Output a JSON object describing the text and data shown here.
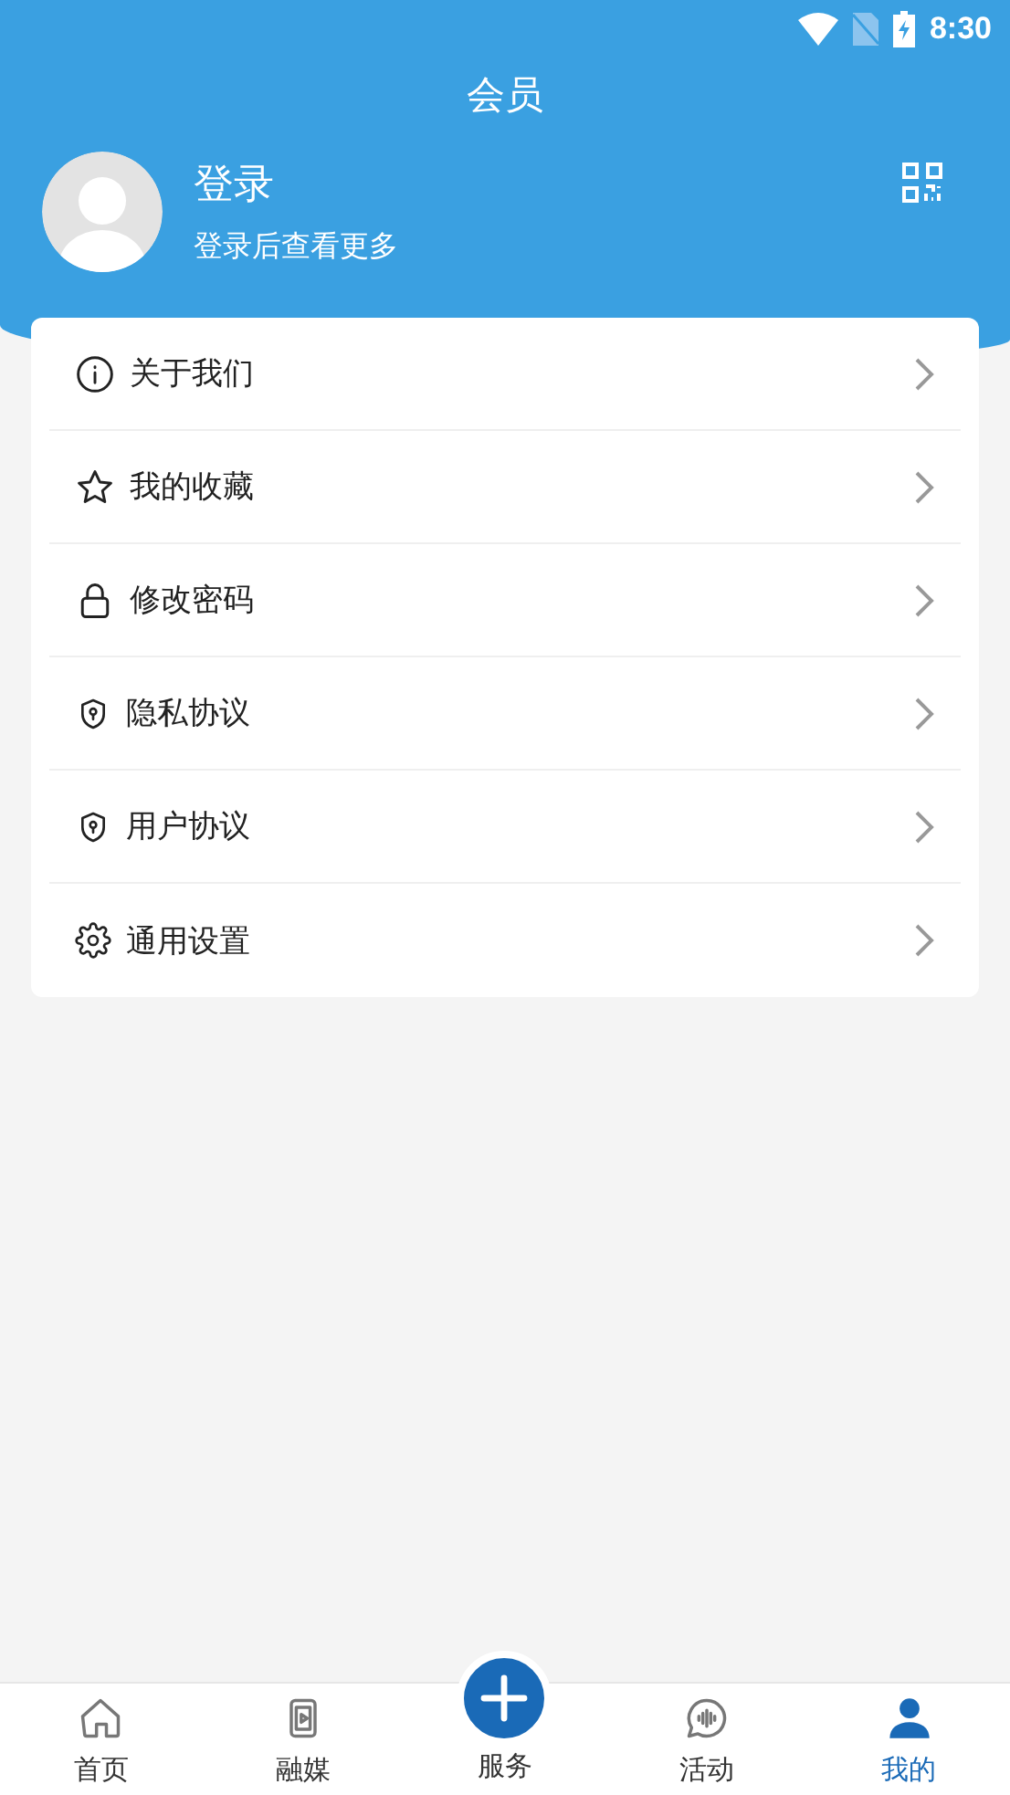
{
  "status_bar": {
    "time": "8:30"
  },
  "header": {
    "title": "会员"
  },
  "profile": {
    "name": "登录",
    "subtitle": "登录后查看更多"
  },
  "menu": [
    {
      "kind": "info",
      "label": "关于我们"
    },
    {
      "kind": "star",
      "label": "我的收藏"
    },
    {
      "kind": "lock",
      "label": "修改密码"
    },
    {
      "kind": "shield",
      "label": "隐私协议"
    },
    {
      "kind": "shield",
      "label": "用户协议"
    },
    {
      "kind": "gear",
      "label": "通用设置"
    }
  ],
  "tabs": [
    {
      "kind": "home",
      "label": "首页",
      "selected": false
    },
    {
      "kind": "media",
      "label": "融媒",
      "selected": false
    },
    {
      "kind": "plus",
      "label": "服务",
      "selected": false
    },
    {
      "kind": "chat",
      "label": "活动",
      "selected": false
    },
    {
      "kind": "user",
      "label": "我的",
      "selected": true
    }
  ]
}
